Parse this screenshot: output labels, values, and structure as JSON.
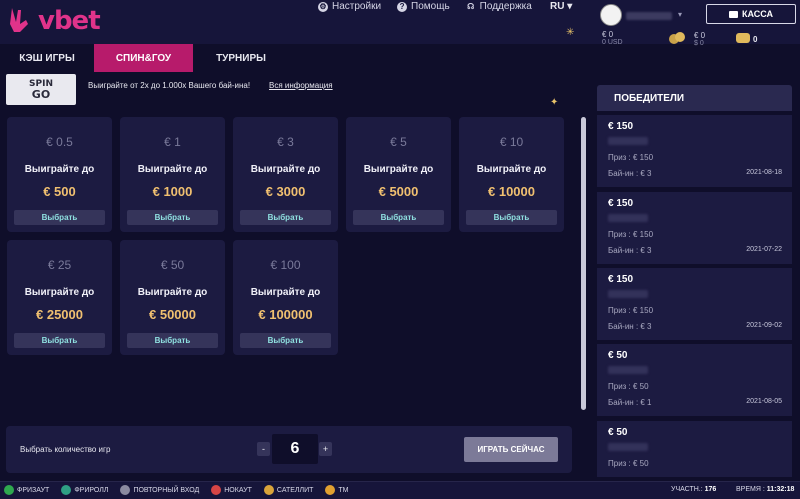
{
  "brand": {
    "name": "vbet"
  },
  "topnav": [
    {
      "label": "Настройки",
      "icon": "gear-icon"
    },
    {
      "label": "Помощь",
      "icon": "help-icon"
    },
    {
      "label": "Поддержка",
      "icon": "headset-icon"
    }
  ],
  "language": "RU",
  "account": {
    "balance_main": "€ 0",
    "balance_main_usd": "0 USD",
    "balance_casino": "€ 0",
    "balance_casino_sub": "$ 0",
    "bonus": "0",
    "cashier_label": "КАССА"
  },
  "tabs": [
    {
      "label": "КЭШ ИГРЫ",
      "active": false
    },
    {
      "label": "СПИН&ГОУ",
      "active": true
    },
    {
      "label": "ТУРНИРЫ",
      "active": false
    }
  ],
  "info": {
    "logo_line1": "SPIN",
    "logo_line2": "GO",
    "text": "Выиграйте от 2x до 1.000x Вашего бай-ина!",
    "link": "Вся информация"
  },
  "cards": [
    {
      "buyin": "€ 0.5",
      "win_label": "Выиграйте до",
      "prize": "€ 500",
      "button": "Выбрать"
    },
    {
      "buyin": "€ 1",
      "win_label": "Выиграйте до",
      "prize": "€ 1000",
      "button": "Выбрать"
    },
    {
      "buyin": "€ 3",
      "win_label": "Выиграйте до",
      "prize": "€ 3000",
      "button": "Выбрать"
    },
    {
      "buyin": "€ 5",
      "win_label": "Выиграйте до",
      "prize": "€ 5000",
      "button": "Выбрать"
    },
    {
      "buyin": "€ 10",
      "win_label": "Выиграйте до",
      "prize": "€ 10000",
      "button": "Выбрать"
    },
    {
      "buyin": "€ 25",
      "win_label": "Выиграйте до",
      "prize": "€ 25000",
      "button": "Выбрать"
    },
    {
      "buyin": "€ 50",
      "win_label": "Выиграйте до",
      "prize": "€ 50000",
      "button": "Выбрать"
    },
    {
      "buyin": "€ 100",
      "win_label": "Выиграйте до",
      "prize": "€ 100000",
      "button": "Выбрать"
    }
  ],
  "count_bar": {
    "label": "Выбрать количество игр",
    "minus": "-",
    "value": "6",
    "plus": "+",
    "play_button": "ИГРАТЬ СЕЙЧАС"
  },
  "winners": {
    "title": "ПОБЕДИТЕЛИ",
    "items": [
      {
        "amount": "€ 150",
        "prize": "Приз : € 150",
        "buyin": "Бай-ин : € 3",
        "date": "2021-08-18"
      },
      {
        "amount": "€ 150",
        "prize": "Приз : € 150",
        "buyin": "Бай-ин : € 3",
        "date": "2021-07-22"
      },
      {
        "amount": "€ 150",
        "prize": "Приз : € 150",
        "buyin": "Бай-ин : € 3",
        "date": "2021-09-02"
      },
      {
        "amount": "€ 50",
        "prize": "Приз : € 50",
        "buyin": "Бай-ин : € 1",
        "date": "2021-08-05"
      },
      {
        "amount": "€ 50",
        "prize": "Приз : € 50",
        "buyin": "",
        "date": ""
      }
    ]
  },
  "footer": {
    "legend": [
      {
        "label": "ФРИЗАУТ",
        "color": "#2fa84f"
      },
      {
        "label": "ФРИРОЛЛ",
        "color": "#2fa084"
      },
      {
        "label": "ПОВТОРНЫЙ ВХОД",
        "color": "#8a8aa0"
      },
      {
        "label": "НОКАУТ",
        "color": "#d64545"
      },
      {
        "label": "САТЕЛЛИТ",
        "color": "#d9a43a"
      },
      {
        "label": "ТМ",
        "color": "#e0a030"
      }
    ],
    "participants_label": "УЧАСТН.:",
    "participants": "176",
    "time_label": "ВРЕМЯ :",
    "time": "11:32:18"
  },
  "colors": {
    "accent": "#b71b6b",
    "brand": "#e0338a",
    "prize": "#f0c070",
    "background": "#0f0e2a",
    "card": "#1c1b41"
  }
}
